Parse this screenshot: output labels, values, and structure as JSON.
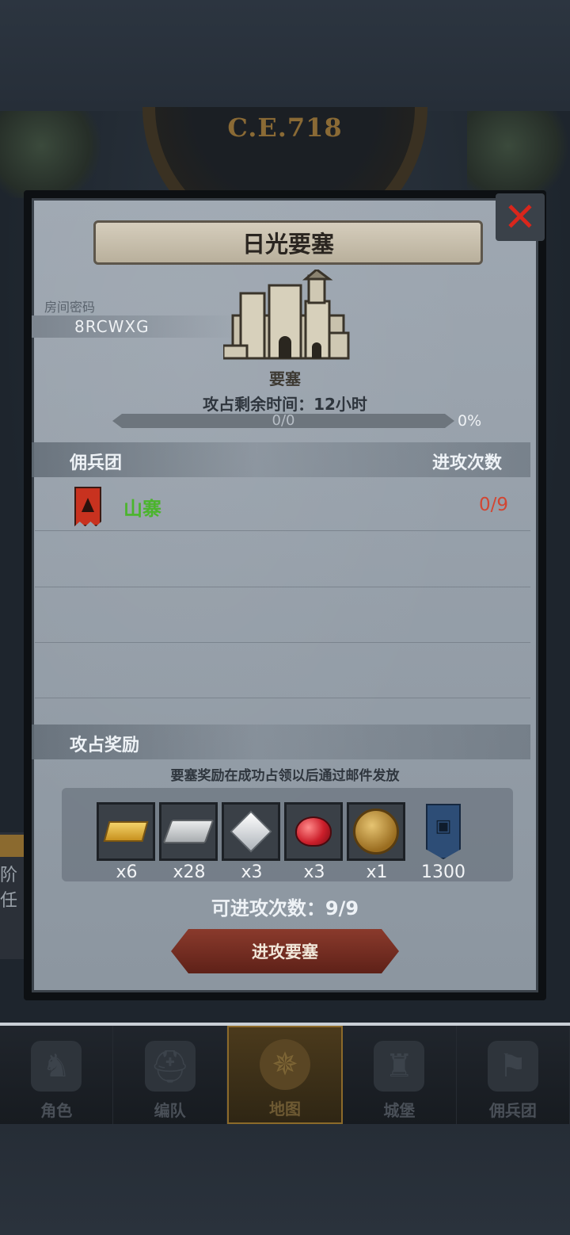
{
  "header": {
    "era_label": "C.E.718"
  },
  "dialog": {
    "title": "日光要塞",
    "room_label": "房间密码",
    "room_code": "8RCWXG",
    "building_name": "要塞",
    "capture_time": "攻占剩余时间：12小时",
    "progress": {
      "text": "0/0",
      "percent_text": "0%",
      "fraction": 0
    },
    "mercenary_header": "佣兵团",
    "attack_count_header": "进攻次数",
    "mercenaries": [
      {
        "name": "山寨",
        "attacks": "0/9",
        "name_color": "#4bb52c",
        "count_color": "#d24632"
      }
    ],
    "reward_header": "攻占奖励",
    "reward_note": "要塞奖励在成功占领以后通过邮件发放",
    "rewards": [
      {
        "icon": "gold-bar-icon",
        "qty": "x6"
      },
      {
        "icon": "silver-bar-icon",
        "qty": "x28"
      },
      {
        "icon": "diamond-icon",
        "qty": "x3"
      },
      {
        "icon": "ruby-icon",
        "qty": "x3"
      },
      {
        "icon": "knight-medal-icon",
        "qty": "x1"
      },
      {
        "icon": "guild-badge-icon",
        "qty": "1300"
      }
    ],
    "attacks_remaining": "可进攻次数：9/9",
    "attack_button": "进攻要塞",
    "close_icon": "close-icon"
  },
  "side_stub": {
    "line1": "阶",
    "line2": "任"
  },
  "nav": {
    "items": [
      {
        "label": "角色",
        "icon": "knight-icon"
      },
      {
        "label": "编队",
        "icon": "helmet-icon"
      },
      {
        "label": "地图",
        "icon": "compass-icon",
        "active": true
      },
      {
        "label": "城堡",
        "icon": "castle-icon"
      },
      {
        "label": "佣兵团",
        "icon": "flag-icon"
      }
    ]
  },
  "colors": {
    "accent_red": "#d9261c",
    "merc_green": "#4bb52c",
    "count_red": "#d24632"
  }
}
